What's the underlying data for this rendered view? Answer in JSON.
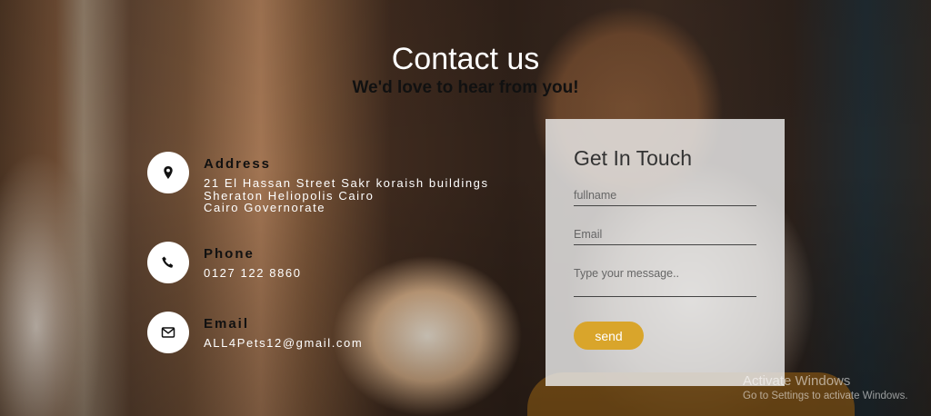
{
  "header": {
    "title": "Contact us",
    "subtitle": "We'd love to hear from you!"
  },
  "contact_info": [
    {
      "icon": "map-pin-icon",
      "title": "Address",
      "value": "21 El Hassan Street Sakr koraish buildings\nSheraton Heliopolis Cairo\nCairo Governorate"
    },
    {
      "icon": "phone-icon",
      "title": "Phone",
      "value": "0127 122 8860"
    },
    {
      "icon": "envelope-icon",
      "title": "Email",
      "value": "ALL4Pets12@gmail.com"
    }
  ],
  "form": {
    "title": "Get In Touch",
    "fullname_placeholder": "fullname",
    "email_placeholder": "Email",
    "message_placeholder": "Type your message..",
    "send_label": "send",
    "accent_color": "#d9a52b"
  },
  "watermark": {
    "title": "Activate Windows",
    "subtitle": "Go to Settings to activate Windows."
  }
}
